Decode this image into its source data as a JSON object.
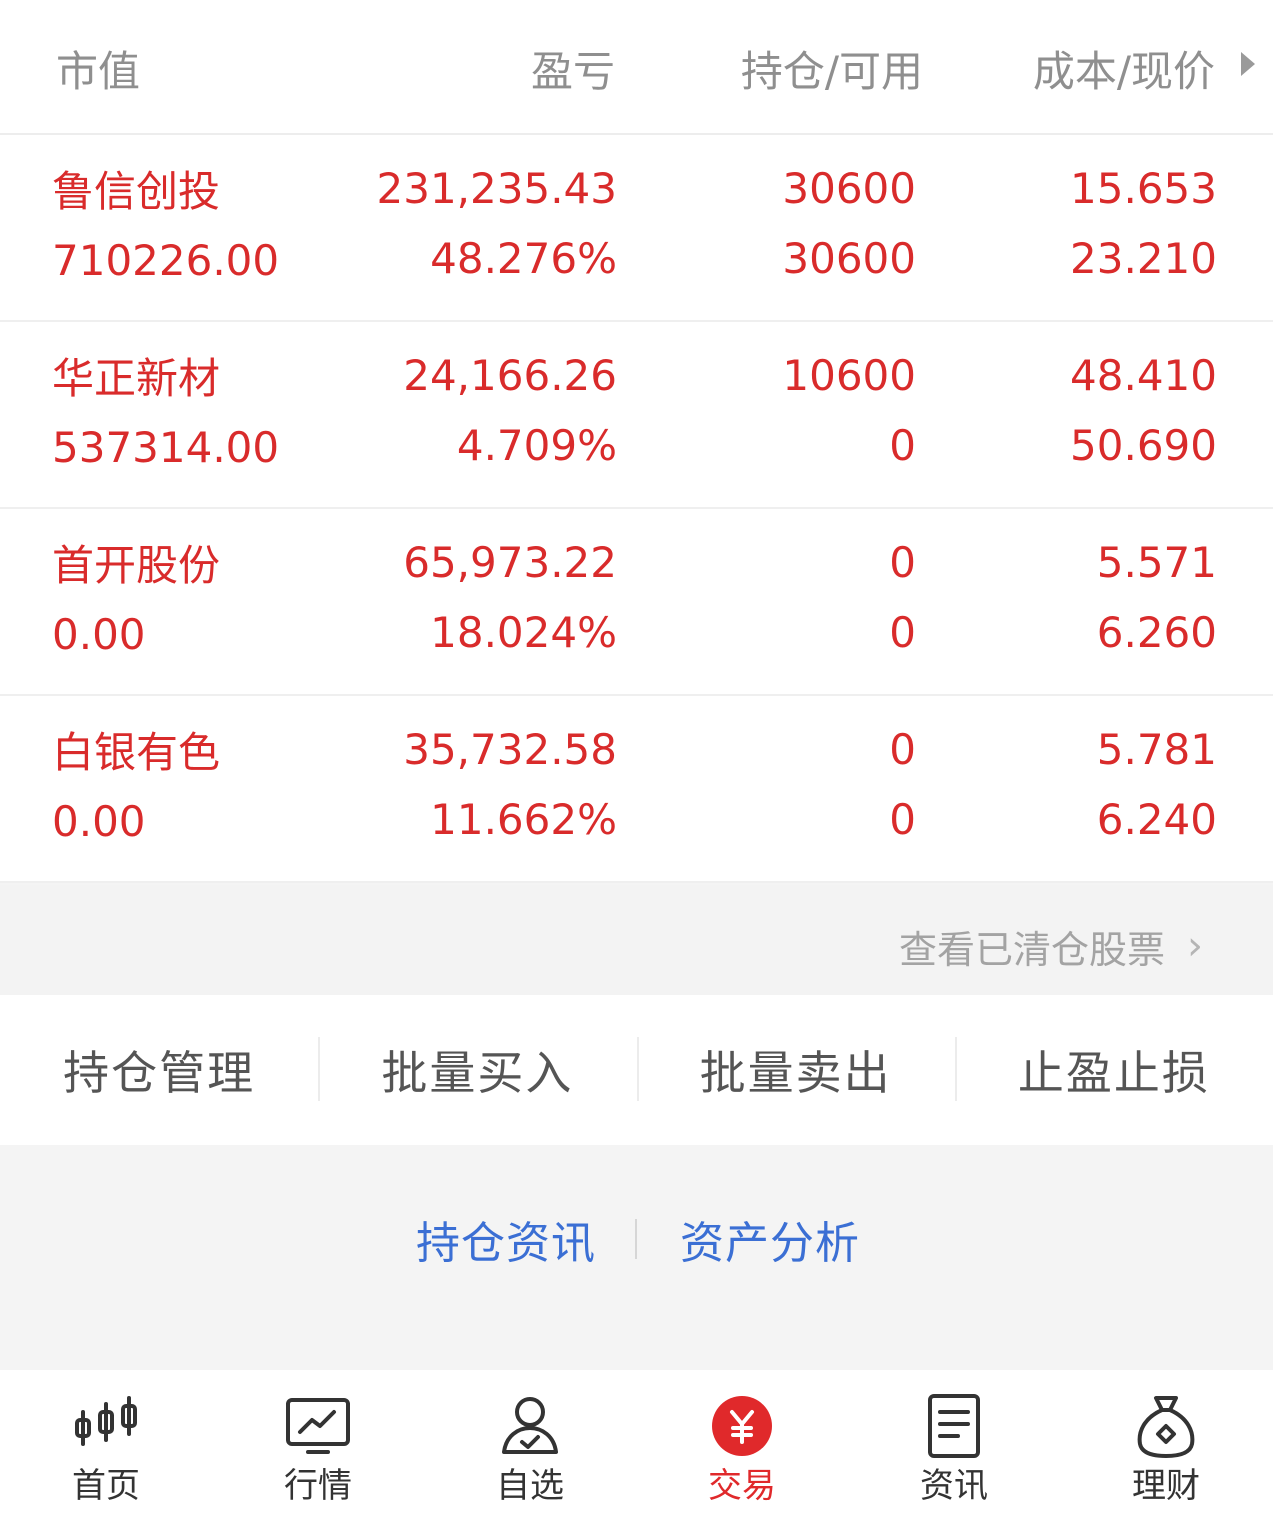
{
  "header": {
    "market_value": "市值",
    "pnl": "盈亏",
    "holding_available": "持仓/可用",
    "cost_price": "成本/现价"
  },
  "positions": [
    {
      "name": "鲁信创投",
      "market_value": "710226.00",
      "pnl": "231,235.43",
      "pnl_pct": "48.276%",
      "holding": "30600",
      "available": "30600",
      "cost": "15.653",
      "price": "23.210"
    },
    {
      "name": "华正新材",
      "market_value": "537314.00",
      "pnl": "24,166.26",
      "pnl_pct": "4.709%",
      "holding": "10600",
      "available": "0",
      "cost": "48.410",
      "price": "50.690"
    },
    {
      "name": "首开股份",
      "market_value": "0.00",
      "pnl": "65,973.22",
      "pnl_pct": "18.024%",
      "holding": "0",
      "available": "0",
      "cost": "5.571",
      "price": "6.260"
    },
    {
      "name": "白银有色",
      "market_value": "0.00",
      "pnl": "35,732.58",
      "pnl_pct": "11.662%",
      "holding": "0",
      "available": "0",
      "cost": "5.781",
      "price": "6.240"
    }
  ],
  "cleared_link": "查看已清仓股票",
  "actions": [
    "持仓管理",
    "批量买入",
    "批量卖出",
    "止盈止损"
  ],
  "info_links": [
    "持仓资讯",
    "资产分析"
  ],
  "tabbar": {
    "items": [
      {
        "label": "首页",
        "icon": "candlestick-icon"
      },
      {
        "label": "行情",
        "icon": "chart-icon"
      },
      {
        "label": "自选",
        "icon": "user-check-icon"
      },
      {
        "label": "交易",
        "icon": "yen-circle-icon",
        "active": true
      },
      {
        "label": "资讯",
        "icon": "document-icon"
      },
      {
        "label": "理财",
        "icon": "money-bag-icon"
      }
    ]
  },
  "colors": {
    "up_red": "#d92b2b",
    "active_tab": "#e0292b",
    "link_blue": "#3b6fd4"
  }
}
